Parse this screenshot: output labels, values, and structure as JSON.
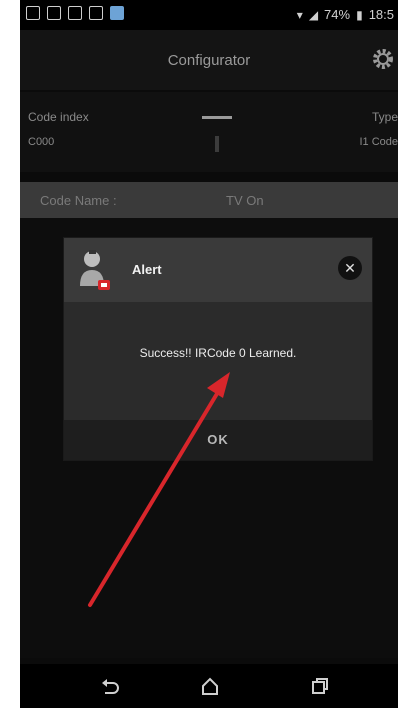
{
  "status_bar": {
    "battery_percent": "74%",
    "time": "18:5"
  },
  "app_bar": {
    "title": "Configurator",
    "icons": [
      "gear-icon"
    ]
  },
  "code_row": {
    "left_label": "Code index",
    "left_value": "C000",
    "right_label": "Type",
    "right_value": "I1 Code"
  },
  "name_bar": {
    "label": "Code Name :",
    "value": "TV On"
  },
  "dialog": {
    "title": "Alert",
    "message": "Success!! IRCode 0 Learned.",
    "ok_label": "OK",
    "icons": [
      "avatar-icon",
      "close-icon"
    ]
  },
  "nav_bar": {
    "icons": [
      "back-icon",
      "home-icon",
      "recents-icon"
    ]
  },
  "colors": {
    "background": "#0b0b0b",
    "dialog": "#2c2c2c",
    "annotation_arrow": "#d8262b"
  }
}
